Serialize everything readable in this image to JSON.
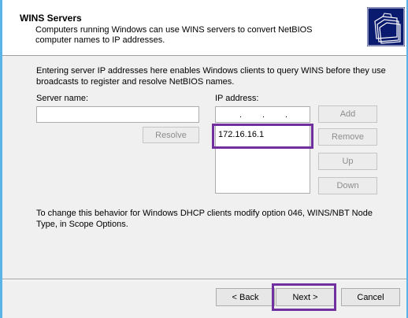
{
  "header": {
    "title": "WINS Servers",
    "subtitle": "Computers running Windows can use WINS servers to convert NetBIOS computer names to IP addresses."
  },
  "body": {
    "intro": "Entering server IP addresses here enables Windows clients to query WINS before they use broadcasts to register and resolve NetBIOS names.",
    "server_name_label": "Server name:",
    "server_name_value": "",
    "ip_address_label": "IP address:",
    "ip_list": [
      "172.16.16.1"
    ],
    "note": "To change this behavior for Windows DHCP clients modify option 046, WINS/NBT Node Type, in Scope Options."
  },
  "buttons": {
    "resolve": "Resolve",
    "add": "Add",
    "remove": "Remove",
    "up": "Up",
    "down": "Down",
    "back": "< Back",
    "next": "Next >",
    "cancel": "Cancel"
  },
  "colors": {
    "desktop": "#5ab4e8",
    "highlight": "#7030a0",
    "icon_bg": "#0a1a6e"
  }
}
